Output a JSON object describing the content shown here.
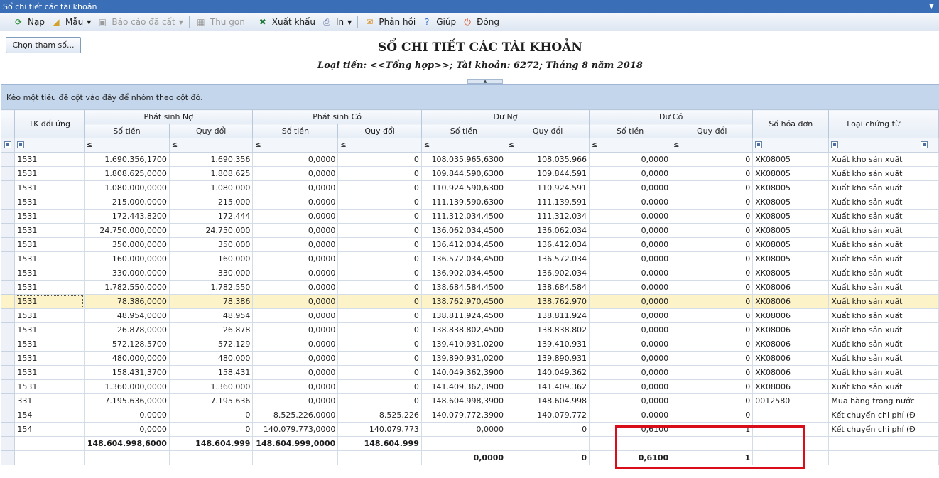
{
  "window": {
    "title": "Sổ chi tiết các tài khoản"
  },
  "toolbar": {
    "items": [
      {
        "name": "reload",
        "label": "Nạp",
        "icon": "reload-icon",
        "glyph": "⟳",
        "color": "#2a8a35",
        "enabled": true,
        "dropdown": false
      },
      {
        "name": "template",
        "label": "Mẫu",
        "icon": "template-icon",
        "glyph": "◢",
        "color": "#d0a22a",
        "enabled": true,
        "dropdown": true
      },
      {
        "name": "saved-report",
        "label": "Báo cáo đã cất",
        "icon": "save-icon",
        "glyph": "▣",
        "color": "#9a9a9a",
        "enabled": false,
        "dropdown": true
      },
      {
        "name": "collapse",
        "label": "Thu gọn",
        "icon": "collapse-icon",
        "glyph": "▦",
        "color": "#9a9a9a",
        "enabled": false,
        "dropdown": false
      },
      {
        "name": "export",
        "label": "Xuất khẩu",
        "icon": "excel-icon",
        "glyph": "✖",
        "color": "#1f7a3a",
        "enabled": true,
        "dropdown": false
      },
      {
        "name": "print",
        "label": "In",
        "icon": "print-icon",
        "glyph": "⎙",
        "color": "#5a6b9a",
        "enabled": true,
        "dropdown": true
      },
      {
        "name": "feedback",
        "label": "Phản hồi",
        "icon": "mail-icon",
        "glyph": "✉",
        "color": "#d98a1a",
        "enabled": true,
        "dropdown": false
      },
      {
        "name": "help",
        "label": "Giúp",
        "icon": "help-icon",
        "glyph": "?",
        "color": "#2f6fc6",
        "enabled": true,
        "dropdown": false
      },
      {
        "name": "close",
        "label": "Đóng",
        "icon": "power-icon",
        "glyph": "⏻",
        "color": "#d9481a",
        "enabled": true,
        "dropdown": false
      }
    ]
  },
  "params_button": "Chọn tham số...",
  "report": {
    "title": "SỔ CHI TIẾT CÁC TÀI KHOẢN",
    "subtitle": "Loại tiền: <<Tổng hợp>>; Tài khoản: 6272; Tháng 8 năm 2018"
  },
  "group_panel": "Kéo một tiêu đề cột vào đây để nhóm theo cột đó.",
  "grid": {
    "headers": {
      "tk_doi_ung": "TK đối ứng",
      "ps_no": "Phát sinh Nợ",
      "ps_co": "Phát sinh Có",
      "du_no": "Dư Nợ",
      "du_co": "Dư Có",
      "so_tien": "Số tiền",
      "quy_doi": "Quy đổi",
      "so_hoa_don": "Số hóa đơn",
      "loai_chung_tu": "Loại chứng từ"
    },
    "filter_op": "≤",
    "rows": [
      [
        "1531",
        "1.690.356,1700",
        "1.690.356",
        "0,0000",
        "0",
        "108.035.965,6300",
        "108.035.966",
        "0,0000",
        "0",
        "XK08005",
        "Xuất kho sản xuất"
      ],
      [
        "1531",
        "1.808.625,0000",
        "1.808.625",
        "0,0000",
        "0",
        "109.844.590,6300",
        "109.844.591",
        "0,0000",
        "0",
        "XK08005",
        "Xuất kho sản xuất"
      ],
      [
        "1531",
        "1.080.000,0000",
        "1.080.000",
        "0,0000",
        "0",
        "110.924.590,6300",
        "110.924.591",
        "0,0000",
        "0",
        "XK08005",
        "Xuất kho sản xuất"
      ],
      [
        "1531",
        "215.000,0000",
        "215.000",
        "0,0000",
        "0",
        "111.139.590,6300",
        "111.139.591",
        "0,0000",
        "0",
        "XK08005",
        "Xuất kho sản xuất"
      ],
      [
        "1531",
        "172.443,8200",
        "172.444",
        "0,0000",
        "0",
        "111.312.034,4500",
        "111.312.034",
        "0,0000",
        "0",
        "XK08005",
        "Xuất kho sản xuất"
      ],
      [
        "1531",
        "24.750.000,0000",
        "24.750.000",
        "0,0000",
        "0",
        "136.062.034,4500",
        "136.062.034",
        "0,0000",
        "0",
        "XK08005",
        "Xuất kho sản xuất"
      ],
      [
        "1531",
        "350.000,0000",
        "350.000",
        "0,0000",
        "0",
        "136.412.034,4500",
        "136.412.034",
        "0,0000",
        "0",
        "XK08005",
        "Xuất kho sản xuất"
      ],
      [
        "1531",
        "160.000,0000",
        "160.000",
        "0,0000",
        "0",
        "136.572.034,4500",
        "136.572.034",
        "0,0000",
        "0",
        "XK08005",
        "Xuất kho sản xuất"
      ],
      [
        "1531",
        "330.000,0000",
        "330.000",
        "0,0000",
        "0",
        "136.902.034,4500",
        "136.902.034",
        "0,0000",
        "0",
        "XK08005",
        "Xuất kho sản xuất"
      ],
      [
        "1531",
        "1.782.550,0000",
        "1.782.550",
        "0,0000",
        "0",
        "138.684.584,4500",
        "138.684.584",
        "0,0000",
        "0",
        "XK08006",
        "Xuất kho sản xuất"
      ],
      [
        "1531",
        "78.386,0000",
        "78.386",
        "0,0000",
        "0",
        "138.762.970,4500",
        "138.762.970",
        "0,0000",
        "0",
        "XK08006",
        "Xuất kho sản xuất"
      ],
      [
        "1531",
        "48.954,0000",
        "48.954",
        "0,0000",
        "0",
        "138.811.924,4500",
        "138.811.924",
        "0,0000",
        "0",
        "XK08006",
        "Xuất kho sản xuất"
      ],
      [
        "1531",
        "26.878,0000",
        "26.878",
        "0,0000",
        "0",
        "138.838.802,4500",
        "138.838.802",
        "0,0000",
        "0",
        "XK08006",
        "Xuất kho sản xuất"
      ],
      [
        "1531",
        "572.128,5700",
        "572.129",
        "0,0000",
        "0",
        "139.410.931,0200",
        "139.410.931",
        "0,0000",
        "0",
        "XK08006",
        "Xuất kho sản xuất"
      ],
      [
        "1531",
        "480.000,0000",
        "480.000",
        "0,0000",
        "0",
        "139.890.931,0200",
        "139.890.931",
        "0,0000",
        "0",
        "XK08006",
        "Xuất kho sản xuất"
      ],
      [
        "1531",
        "158.431,3700",
        "158.431",
        "0,0000",
        "0",
        "140.049.362,3900",
        "140.049.362",
        "0,0000",
        "0",
        "XK08006",
        "Xuất kho sản xuất"
      ],
      [
        "1531",
        "1.360.000,0000",
        "1.360.000",
        "0,0000",
        "0",
        "141.409.362,3900",
        "141.409.362",
        "0,0000",
        "0",
        "XK08006",
        "Xuất kho sản xuất"
      ],
      [
        "331",
        "7.195.636,0000",
        "7.195.636",
        "0,0000",
        "0",
        "148.604.998,3900",
        "148.604.998",
        "0,0000",
        "0",
        "0012580",
        "Mua hàng trong nước"
      ],
      [
        "154",
        "0,0000",
        "0",
        "8.525.226,0000",
        "8.525.226",
        "140.079.772,3900",
        "140.079.772",
        "0,0000",
        "0",
        "",
        "Kết chuyển chi phí (Đ"
      ],
      [
        "154",
        "0,0000",
        "0",
        "140.079.773,0000",
        "140.079.773",
        "0,0000",
        "0",
        "0,6100",
        "1",
        "",
        "Kết chuyển chi phí (Đ"
      ]
    ],
    "selected_row": 10,
    "totals_1": [
      "",
      "148.604.998,6000",
      "148.604.999",
      "148.604.999,0000",
      "148.604.999",
      "",
      "",
      "",
      "",
      "",
      ""
    ],
    "totals_2": [
      "",
      "",
      "",
      "",
      "",
      "0,0000",
      "0",
      "0,6100",
      "1",
      "",
      ""
    ]
  }
}
